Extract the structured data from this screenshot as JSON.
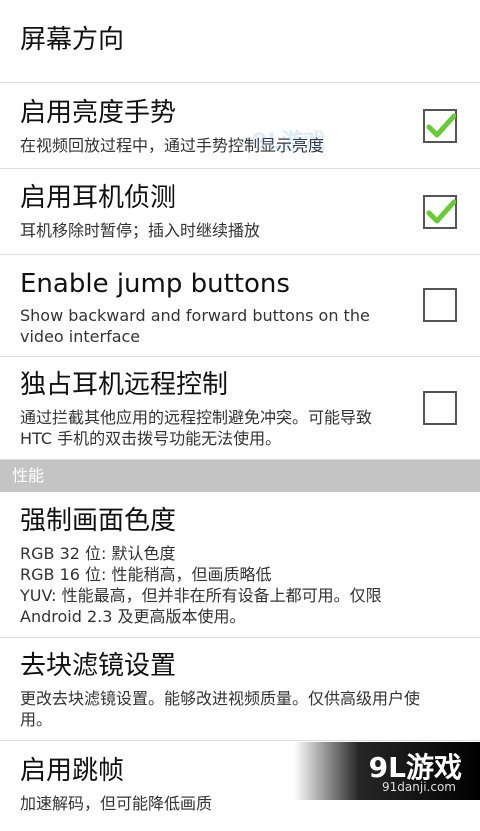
{
  "screen_orientation": {
    "title": "屏幕方向"
  },
  "prefs": [
    {
      "id": "brightness_gesture",
      "title": "启用亮度手势",
      "summary": "在视频回放过程中，通过手势控制显示亮度",
      "checked": true
    },
    {
      "id": "headset_detection",
      "title": "启用耳机侦测",
      "summary": "耳机移除时暂停；插入时继续播放",
      "checked": true
    },
    {
      "id": "jump_buttons",
      "title": "Enable jump buttons",
      "summary": "Show backward and forward buttons on the video interface",
      "checked": false
    },
    {
      "id": "headset_remote",
      "title": "独占耳机远程控制",
      "summary": "通过拦截其他应用的远程控制避免冲突。可能导致 HTC 手机的双击拨号功能无法使用。",
      "checked": false
    }
  ],
  "category": {
    "label": "性能"
  },
  "performance": [
    {
      "id": "chroma",
      "title": "强制画面色度",
      "summary_lines": [
        "RGB 32 位: 默认色度",
        "RGB 16 位: 性能稍高，但画质略低",
        "YUV: 性能最高，但并非在所有设备上都可用。仅限 Android 2.3 及更高版本使用。"
      ]
    },
    {
      "id": "deblocking",
      "title": "去块滤镜设置",
      "summary": "更改去块滤镜设置。能够改进视频质量。仅供高级用户使用。"
    },
    {
      "id": "frame_skip",
      "title": "启用跳帧",
      "summary": "加速解码，但可能降低画质"
    }
  ],
  "theme": {
    "check_color": "#66cc33",
    "divider_color": "#dcdcdc",
    "category_bg": "#c4c4c4"
  },
  "watermark": {
    "text": "9L游戏"
  },
  "corner_logo": {
    "brand": "9L游戏",
    "url": "91danji.com"
  }
}
